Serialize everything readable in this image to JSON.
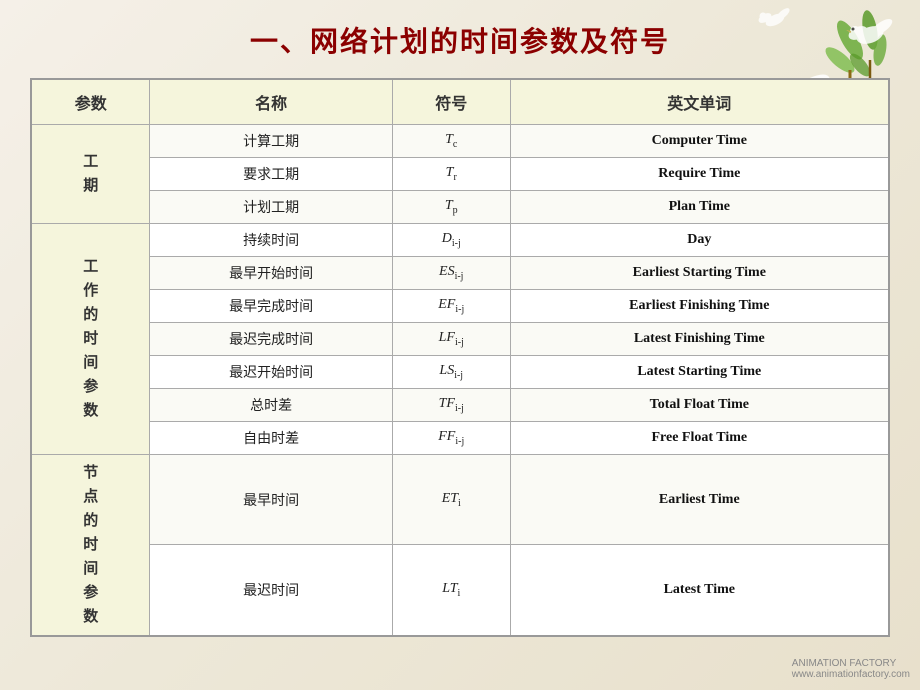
{
  "title": "一、网络计划的时间参数及符号",
  "table": {
    "headers": [
      "参数",
      "名称",
      "符号",
      "英文单词"
    ],
    "groups": [
      {
        "groupLabel": "工\n期",
        "rows": [
          {
            "name": "计算工期",
            "symbol": "T<sub>c</sub>",
            "english": "Computer Time"
          },
          {
            "name": "要求工期",
            "symbol": "T<sub>r</sub>",
            "english": "Require Time"
          },
          {
            "name": "计划工期",
            "symbol": "T<sub>p</sub>",
            "english": "Plan Time"
          }
        ]
      },
      {
        "groupLabel": "工\n作\n的\n时\n间\n参\n数",
        "rows": [
          {
            "name": "持续时间",
            "symbol": "D<sub>i-j</sub>",
            "english": "Day"
          },
          {
            "name": "最早开始时间",
            "symbol": "ES<sub>i-j</sub>",
            "english": "Earliest Starting Time"
          },
          {
            "name": "最早完成时间",
            "symbol": "EF<sub>i-j</sub>",
            "english": "Earliest Finishing Time"
          },
          {
            "name": "最迟完成时间",
            "symbol": "LF<sub>i-j</sub>",
            "english": "Latest Finishing Time"
          },
          {
            "name": "最迟开始时间",
            "symbol": "LS<sub>i-j</sub>",
            "english": "Latest Starting Time"
          },
          {
            "name": "总时差",
            "symbol": "TF<sub>i-j</sub>",
            "english": "Total Float Time"
          },
          {
            "name": "自由时差",
            "symbol": "FF<sub>i-j</sub>",
            "english": "Free Float Time"
          }
        ]
      },
      {
        "groupLabel": "节\n点\n的\n时\n间\n参\n数",
        "rows": [
          {
            "name": "最早时间",
            "symbol": "ET<sub>i</sub>",
            "english": "Earliest Time"
          },
          {
            "name": "最迟时间",
            "symbol": "LT<sub>i</sub>",
            "english": "Latest Time"
          }
        ]
      }
    ]
  },
  "watermark": {
    "line1": "ANIMATION FACTORY",
    "line2": "www.animationfactory.com"
  }
}
